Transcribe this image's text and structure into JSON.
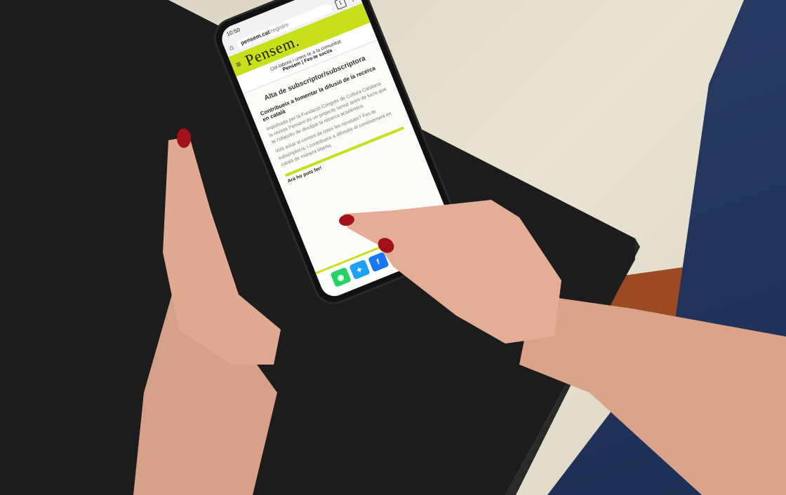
{
  "phone": {
    "status_time": "10:50",
    "status_right": "▾◢ ▪",
    "url_domain": "pensem.cat",
    "url_path": "/registre",
    "tab_count": "1",
    "logo": "Pensem.",
    "banner_line1": "Col·labora i uneix-te a la comunitat",
    "banner_line2": "Pensem | Fes-te soci/a",
    "page_title": "Alta de subscriptor/subscriptora",
    "section_heading": "Contribueix a fomentar la difusió de la recerca en català",
    "para1": "Impulsada per la Fundació Congrés de Cultura Catalana la revista Pensem és un projecte sense ànim de lucre que té l'objectiu de divulgar la recerca acadèmica.",
    "para2": "Vols estar al corrent de totes les novetats? Fes-te subscriptor/a, i contribueix a difondre el coneixement en català de manera oberta.",
    "share_label": "Ara ho pots fer!"
  },
  "share_icons": [
    "whatsapp-icon",
    "twitter-icon",
    "facebook-icon",
    "telegram-icon",
    "linkedin-icon",
    "email-icon"
  ],
  "colors": {
    "brand": "#c8df1b",
    "whatsapp": "#25d366",
    "twitter": "#1da1f2",
    "facebook": "#1877f2",
    "telegram": "#2aa1de",
    "linkedin": "#0a66c2",
    "email": "#888888",
    "nail": "#a3121b"
  }
}
